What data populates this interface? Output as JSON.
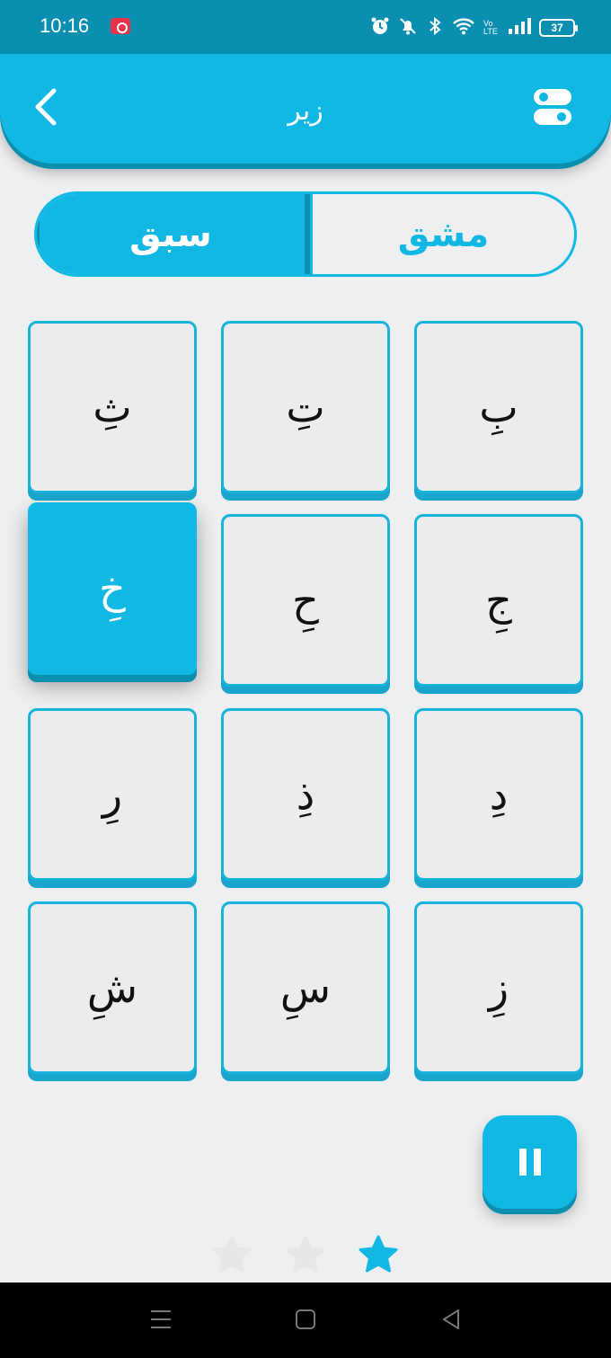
{
  "status_bar": {
    "time": "10:16",
    "battery": "37",
    "icons": [
      "screen-record-icon",
      "alarm-icon",
      "mute-icon",
      "bluetooth-icon",
      "wifi-icon",
      "volte-icon",
      "signal-icon",
      "battery-icon"
    ],
    "volte_label": "Vo LTE"
  },
  "header": {
    "title": "زیر",
    "background_color": "#12b8e4"
  },
  "tabs": {
    "lesson_label": "سبق",
    "practice_label": "مشق",
    "selected": "lesson"
  },
  "letters": [
    {
      "char": "بِ",
      "active": false
    },
    {
      "char": "تِ",
      "active": false
    },
    {
      "char": "ثِ",
      "active": false
    },
    {
      "char": "جِ",
      "active": false
    },
    {
      "char": "حِ",
      "active": false
    },
    {
      "char": "خِ",
      "active": true
    },
    {
      "char": "دِ",
      "active": false
    },
    {
      "char": "ذِ",
      "active": false
    },
    {
      "char": "رِ",
      "active": false
    },
    {
      "char": "زِ",
      "active": false
    },
    {
      "char": "سِ",
      "active": false
    },
    {
      "char": "شِ",
      "active": false
    }
  ],
  "stars": {
    "total": 3,
    "filled": 1
  },
  "colors": {
    "accent": "#12b8e4",
    "accent_dark": "#0c8fae",
    "background": "#eeeff1"
  }
}
